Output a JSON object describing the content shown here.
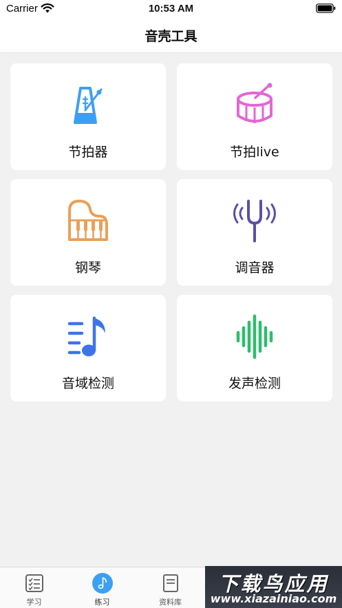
{
  "status_bar": {
    "carrier": "Carrier",
    "time": "10:53 AM"
  },
  "nav": {
    "title": "音壳工具"
  },
  "tools": [
    {
      "label": "节拍器",
      "icon": "metronome-icon",
      "color": "#3d9ff2"
    },
    {
      "label": "节拍live",
      "icon": "drum-icon",
      "color": "#e266d6"
    },
    {
      "label": "钢琴",
      "icon": "piano-icon",
      "color": "#e9a05a"
    },
    {
      "label": "调音器",
      "icon": "tuning-fork-icon",
      "color": "#5a4fa8"
    },
    {
      "label": "音域检测",
      "icon": "music-list-icon",
      "color": "#3d74e8"
    },
    {
      "label": "发声检测",
      "icon": "sound-wave-icon",
      "color": "#2ebd6c"
    }
  ],
  "tab_bar": {
    "tabs": [
      {
        "label": "学习",
        "icon": "checklist-icon"
      },
      {
        "label": "练习",
        "icon": "music-note-icon",
        "active": true
      },
      {
        "label": "资料库",
        "icon": "document-icon"
      },
      {
        "label": "",
        "icon": ""
      },
      {
        "label": "",
        "icon": ""
      }
    ]
  },
  "watermark": {
    "logo_text": "下载鸟应用",
    "url": "www.xiazainiao.com"
  },
  "colors": {
    "tab_active": "#3d9ff2",
    "tab_inactive": "#555555"
  }
}
